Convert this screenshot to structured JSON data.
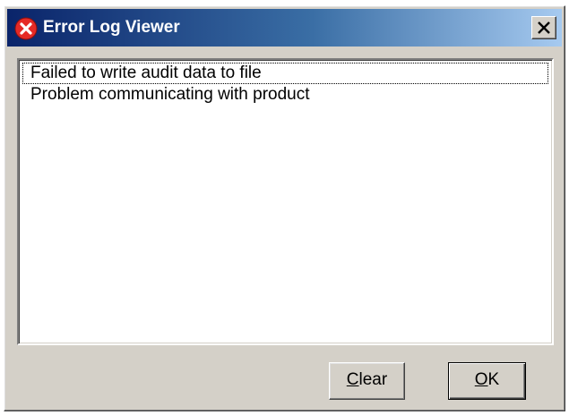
{
  "window": {
    "title": "Error Log Viewer",
    "title_icon": "error-icon",
    "close_icon": "close-icon"
  },
  "log_list": {
    "items": [
      "Failed to write audit data to file",
      "Problem communicating with product"
    ],
    "focused_index": 0
  },
  "buttons": {
    "clear": {
      "mnemonic": "C",
      "rest": "lear"
    },
    "ok": {
      "mnemonic": "O",
      "rest": "K"
    }
  },
  "colors": {
    "titlebar_start": "#0a246a",
    "titlebar_end": "#a6caf0",
    "face": "#d4d0c8",
    "error_red": "#e52a26"
  }
}
